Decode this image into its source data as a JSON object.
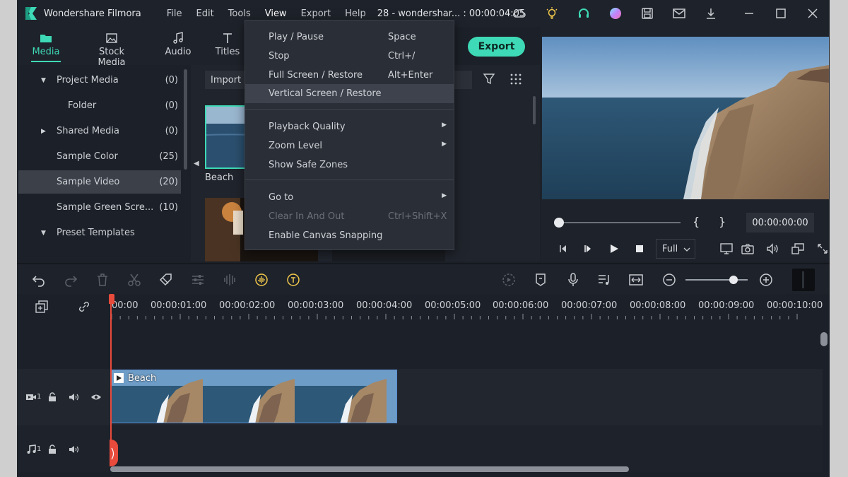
{
  "titlebar": {
    "app_name": "Wondershare Filmora",
    "menus": [
      "File",
      "Edit",
      "Tools",
      "View",
      "Export",
      "Help"
    ],
    "project_title": "28 - wondershar... : 00:00:04:05"
  },
  "media_tabs": [
    {
      "label": "Media",
      "icon": "folder-icon"
    },
    {
      "label": "Stock Media",
      "icon": "image-icon"
    },
    {
      "label": "Audio",
      "icon": "music-note-icon"
    },
    {
      "label": "Titles",
      "icon": "text-icon"
    }
  ],
  "export_label": "Export",
  "tree": [
    {
      "label": "Project Media",
      "count": "(0)",
      "arrow": "▼"
    },
    {
      "label": "Folder",
      "count": "(0)",
      "arrow": ""
    },
    {
      "label": "Shared Media",
      "count": "(0)",
      "arrow": "▶"
    },
    {
      "label": "Sample Color",
      "count": "(25)",
      "arrow": ""
    },
    {
      "label": "Sample Video",
      "count": "(20)",
      "arrow": ""
    },
    {
      "label": "Sample Green Scre...",
      "count": "(10)",
      "arrow": ""
    },
    {
      "label": "Preset Templates",
      "count": "",
      "arrow": "▼"
    }
  ],
  "media": {
    "import_label": "Import",
    "thumb_label": "Beach"
  },
  "view_menu": [
    {
      "label": "Play / Pause",
      "shortcut": "Space"
    },
    {
      "label": "Stop",
      "shortcut": "Ctrl+/"
    },
    {
      "label": "Full Screen / Restore",
      "shortcut": "Alt+Enter"
    },
    {
      "label": "Vertical Screen / Restore",
      "shortcut": ""
    },
    {
      "label": "Playback Quality",
      "shortcut": ""
    },
    {
      "label": "Zoom Level",
      "shortcut": ""
    },
    {
      "label": "Show Safe Zones",
      "shortcut": ""
    },
    {
      "label": "Go to",
      "shortcut": ""
    },
    {
      "label": "Clear In And Out",
      "shortcut": "Ctrl+Shift+X"
    },
    {
      "label": "Enable Canvas Snapping",
      "shortcut": ""
    }
  ],
  "preview": {
    "timecode": "00:00:00:00",
    "brace_open": "{",
    "brace_close": "}",
    "quality": "Full"
  },
  "ruler": {
    "labels": [
      "00:00",
      "00:00:01:00",
      "00:00:02:00",
      "00:00:03:00",
      "00:00:04:00",
      "00:00:05:00",
      "00:00:06:00",
      "00:00:07:00",
      "00:00:08:00",
      "00:00:09:00",
      "00:00:10:00"
    ]
  },
  "tracks": {
    "video_index": "1",
    "audio_index": "1",
    "clip_title": "Beach"
  },
  "colors": {
    "accent": "#3ed9b6",
    "playhead": "#e84b3c",
    "clip_border": "#5a8fd6"
  }
}
